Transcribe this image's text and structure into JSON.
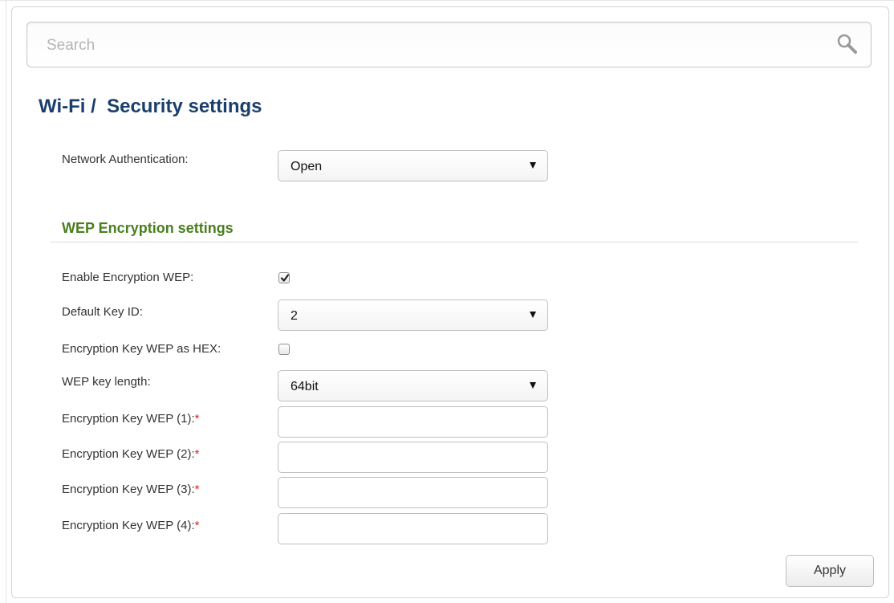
{
  "search": {
    "placeholder": "Search",
    "icon": "search-icon"
  },
  "page": {
    "title": "Wi-Fi /  Security settings"
  },
  "network_auth": {
    "label": "Network Authentication:",
    "value": "Open"
  },
  "wep": {
    "section_title": "WEP Encryption settings",
    "enable": {
      "label": "Enable Encryption WEP:",
      "checked": true
    },
    "default_key_id": {
      "label": "Default Key ID:",
      "value": "2"
    },
    "hex": {
      "label": "Encryption Key WEP as HEX:",
      "checked": false
    },
    "key_length": {
      "label": "WEP key length:",
      "value": "64bit"
    },
    "keys": [
      {
        "label": "Encryption Key WEP (1):",
        "required": "*",
        "value": ""
      },
      {
        "label": "Encryption Key WEP (2):",
        "required": "*",
        "value": ""
      },
      {
        "label": "Encryption Key WEP (3):",
        "required": "*",
        "value": ""
      },
      {
        "label": "Encryption Key WEP (4):",
        "required": "*",
        "value": ""
      }
    ]
  },
  "actions": {
    "apply_label": "Apply"
  },
  "colors": {
    "title": "#1b3f6b",
    "section": "#4a7f1f",
    "required": "#e02020"
  }
}
